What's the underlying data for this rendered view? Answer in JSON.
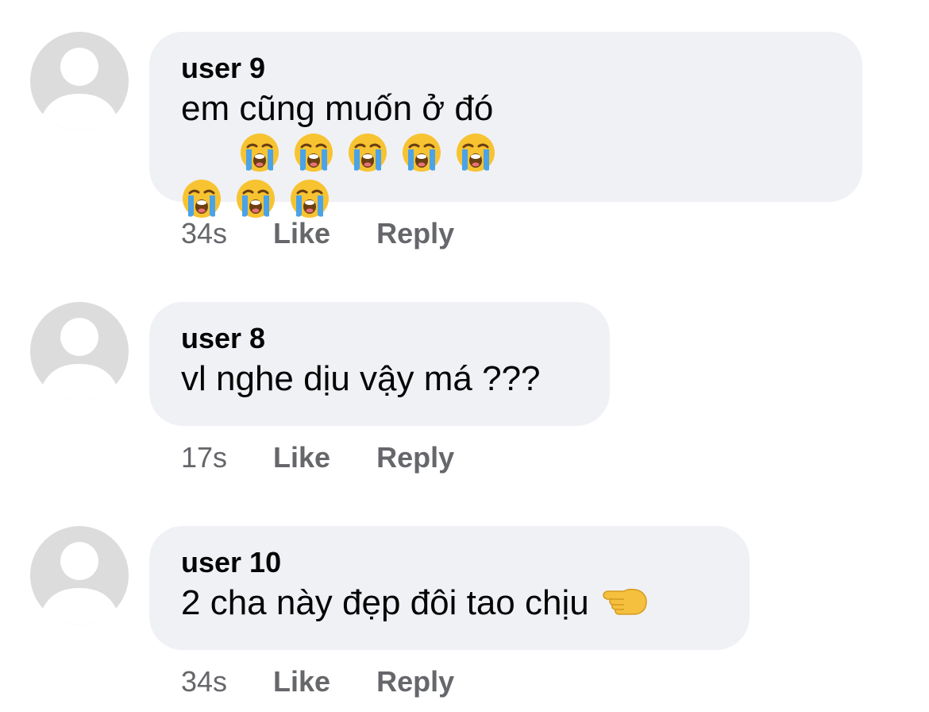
{
  "comments": [
    {
      "author": "user 9",
      "text": "em cũng muốn ở đó",
      "emoji": "loudly-crying-face",
      "emoji_count": 8,
      "time": "34s",
      "like_label": "Like",
      "reply_label": "Reply"
    },
    {
      "author": "user 8",
      "text": "vl nghe dịu vậy má ???",
      "time": "17s",
      "like_label": "Like",
      "reply_label": "Reply"
    },
    {
      "author": "user 10",
      "text": "2 cha này đẹp đôi tao chịu",
      "emoji": "backhand-index-pointing-left",
      "time": "34s",
      "like_label": "Like",
      "reply_label": "Reply"
    }
  ],
  "colors": {
    "bubble": "#f0f1f5",
    "avatar_bg": "#dcdcdc",
    "avatar_fg": "#ffffff",
    "meta_text": "#65676b",
    "body_text": "#050505"
  }
}
